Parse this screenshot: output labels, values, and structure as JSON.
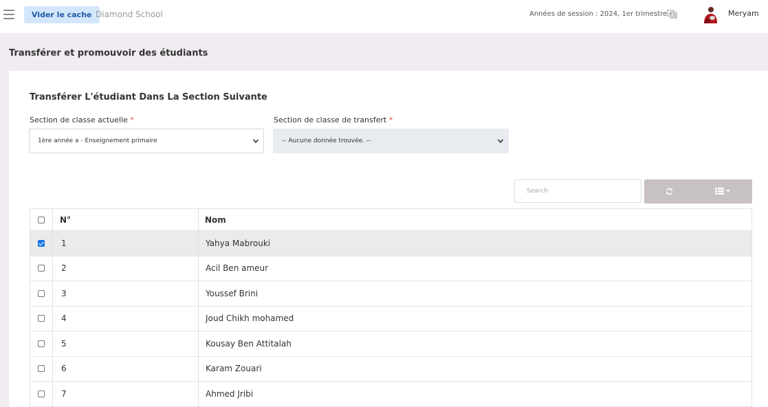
{
  "header": {
    "cache_button": "Vider le cache",
    "school_name": "Diamond School",
    "session_info": "Années de session : 2024, 1er trimestre",
    "user_name": "Meryam"
  },
  "page_title": "Transférer et promouvoir des étudiants",
  "card": {
    "title": "Transférer L'étudiant Dans La Section Suivante",
    "current_section": {
      "label": "Section de classe actuelle",
      "required_mark": "*",
      "value": "1ère année a - Enseignement primaire"
    },
    "transfer_section": {
      "label": "Section de classe de transfert",
      "required_mark": "*",
      "value": "-- Aucune donnée trouvée. --"
    },
    "search_placeholder": "Search"
  },
  "table": {
    "columns": [
      "N°",
      "Nom"
    ],
    "rows": [
      {
        "num": "1",
        "name": "Yahya Mabrouki",
        "checked": true
      },
      {
        "num": "2",
        "name": "Acil Ben ameur",
        "checked": false
      },
      {
        "num": "3",
        "name": "Youssef Brini",
        "checked": false
      },
      {
        "num": "4",
        "name": "Joud Chikh mohamed",
        "checked": false
      },
      {
        "num": "5",
        "name": "Kousay Ben Attitalah",
        "checked": false
      },
      {
        "num": "6",
        "name": "Karam Zouari",
        "checked": false
      },
      {
        "num": "7",
        "name": "Ahmed Jribi",
        "checked": false
      }
    ]
  },
  "colors": {
    "page_bg": "#f1ecf2",
    "cache_button_bg": "#d4e6fb",
    "cache_button_text": "#1e5aa8",
    "toolbar_button_bg": "#c7c1c3",
    "checkbox_checked": "#1a73e8",
    "required_mark": "#e05050"
  },
  "icons": [
    "hamburger-icon",
    "translate-icon",
    "avatar",
    "chevron-down-icon",
    "refresh-icon",
    "columns-list-icon",
    "caret-down-icon"
  ]
}
